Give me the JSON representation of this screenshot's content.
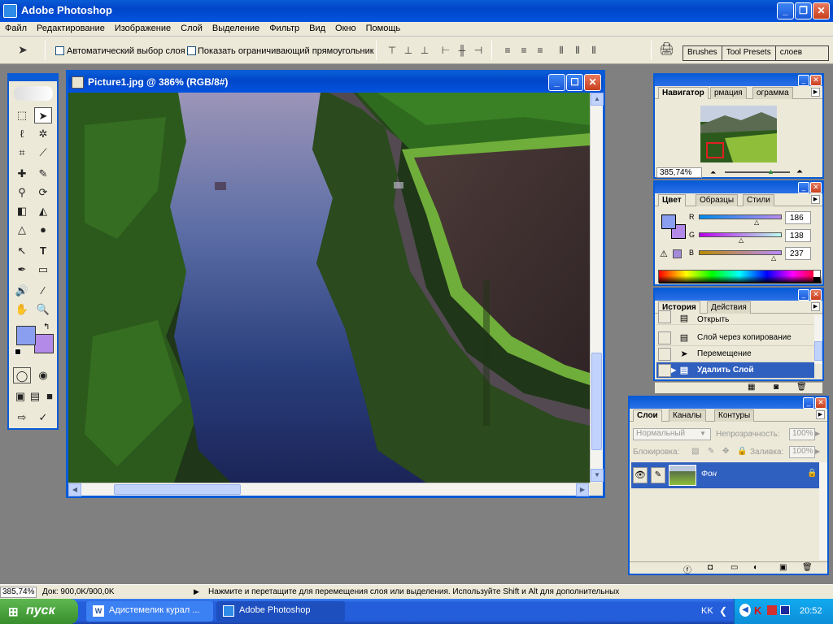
{
  "app": {
    "title": "Adobe Photoshop",
    "window_buttons": {
      "minimize": "_",
      "restore": "❐",
      "close": "✕"
    }
  },
  "menu": [
    "Файл",
    "Редактирование",
    "Изображение",
    "Слой",
    "Выделение",
    "Фильтр",
    "Вид",
    "Окно",
    "Помощь"
  ],
  "options": {
    "auto_select_label": "Автоматический выбор слоя",
    "bounding_box_label": "Показать ограничивающий прямоугольник",
    "palette_well": [
      "Brushes",
      "Tool Presets",
      "слоев"
    ]
  },
  "document": {
    "title": "Picture1.jpg @ 386% (RGB/8#)"
  },
  "navigator": {
    "tabs": [
      "Навигатор",
      "рмация",
      "ограмма"
    ],
    "zoom": "385,74%"
  },
  "color": {
    "tabs": [
      "Цвет",
      "Образцы",
      "Стили"
    ],
    "channels": [
      {
        "label": "R",
        "value": "186"
      },
      {
        "label": "G",
        "value": "138"
      },
      {
        "label": "B",
        "value": "237"
      }
    ],
    "foreground": "#8a9ff0",
    "background": "#b48ae8"
  },
  "history": {
    "tabs": [
      "История",
      "Действия"
    ],
    "items": [
      {
        "label": "Открыть",
        "icon": "document-icon"
      },
      {
        "label": "Слой через копирование",
        "icon": "document-icon"
      },
      {
        "label": "Перемещение",
        "icon": "move-icon"
      },
      {
        "label": "Удалить Слой",
        "icon": "document-icon",
        "selected": true
      }
    ]
  },
  "layers": {
    "tabs": [
      "Слои",
      "Каналы",
      "Контуры"
    ],
    "blend_mode": "Нормальный",
    "opacity_label": "Непрозрачность:",
    "opacity_value": "100%",
    "lock_label": "Блокировка:",
    "fill_label": "Заливка:",
    "fill_value": "100%",
    "layer_name": "Фон"
  },
  "status": {
    "zoom": "385,74%",
    "doc_info": "Док: 900,0K/900,0K",
    "hint": "Нажмите и перетащите для перемещения слоя или выделения. Используйте Shift и Alt для дополнительных"
  },
  "taskbar": {
    "start": "пуск",
    "tasks": [
      "Адистемелик курал ...",
      "Adobe Photoshop"
    ],
    "lang": "KK",
    "clock": "20:52"
  }
}
